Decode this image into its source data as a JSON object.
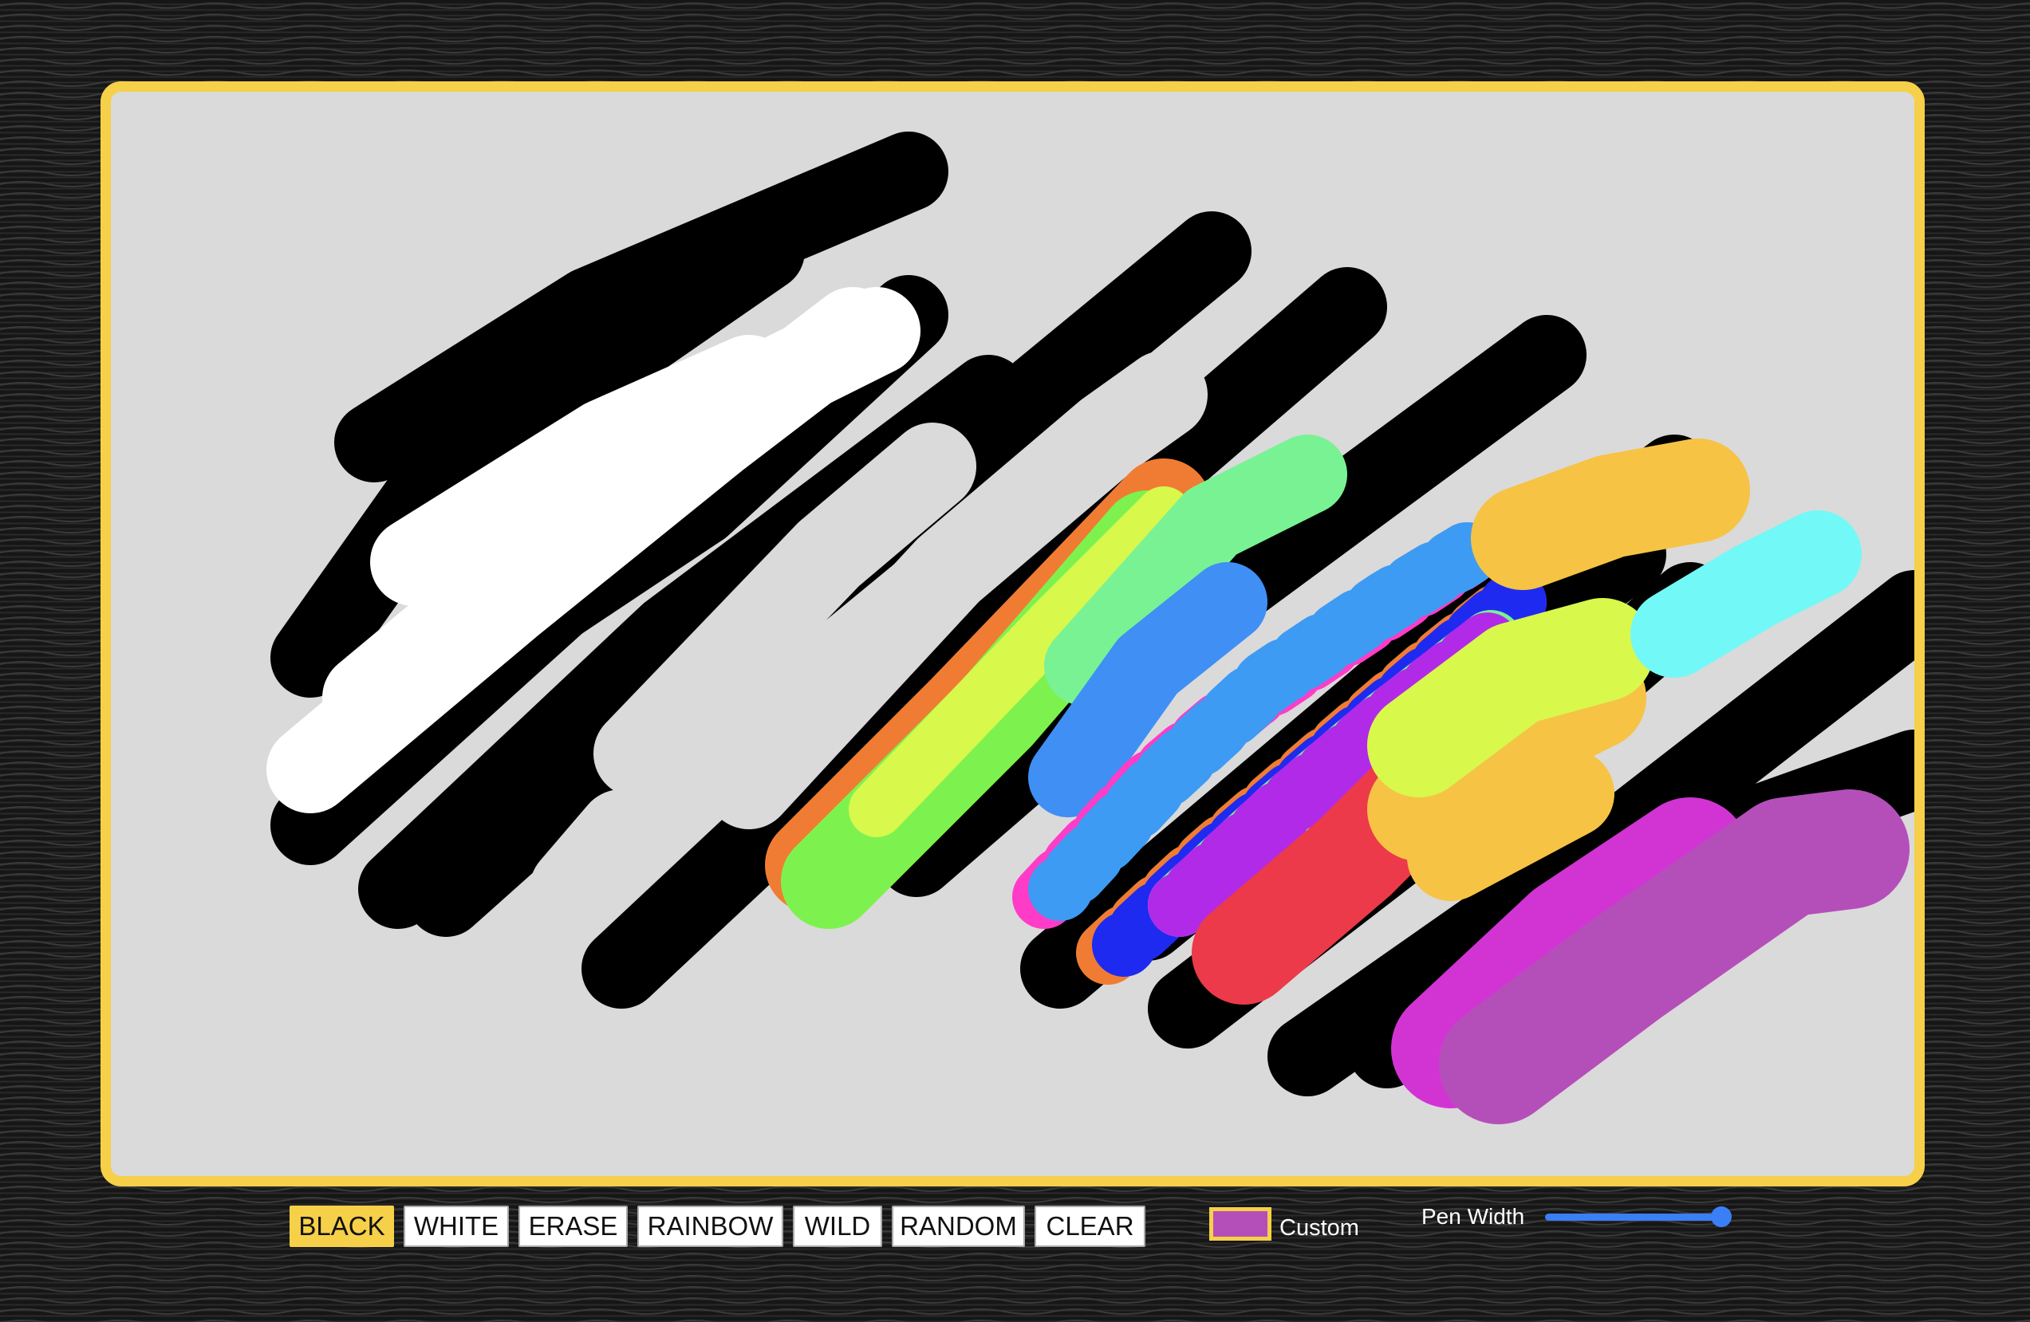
{
  "toolbar": {
    "buttons": [
      {
        "label": "BLACK",
        "active": true
      },
      {
        "label": "WHITE",
        "active": false
      },
      {
        "label": "ERASE",
        "active": false
      },
      {
        "label": "RAINBOW",
        "active": false
      },
      {
        "label": "WILD",
        "active": false
      },
      {
        "label": "RANDOM",
        "active": false
      },
      {
        "label": "CLEAR",
        "active": false
      }
    ],
    "custom_label": "Custom",
    "custom_color": "#b44fba",
    "pen_width_label": "Pen Width",
    "pen_width_level": 0.95
  },
  "colors": {
    "frame": "#f6d048",
    "canvas": "#dadada",
    "active_button": "#f6d048",
    "slider": "#3b7ff6"
  }
}
